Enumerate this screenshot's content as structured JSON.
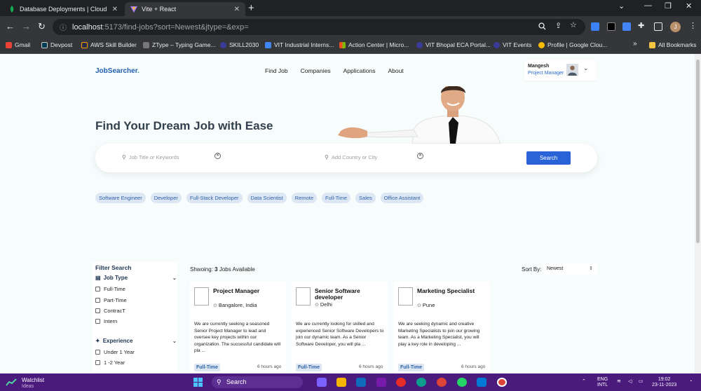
{
  "browser": {
    "tabs": [
      {
        "title": "Database Deployments | Cloud: Mc",
        "active": false,
        "icon": "mongodb-leaf-icon"
      },
      {
        "title": "Vite + React",
        "active": true,
        "icon": "vite-icon"
      }
    ],
    "address": {
      "host": "localhost",
      "path": ":5173/find-jobs?sort=Newest&jtype=&exp="
    },
    "bookmarks": [
      {
        "label": "Gmail",
        "icon": "gmail-icon",
        "color": "#ea4335"
      },
      {
        "label": "Devpost",
        "icon": "devpost-icon",
        "color": "#003e54"
      },
      {
        "label": "AWS Skill Builder",
        "icon": "aws-icon",
        "color": "#232f3e"
      },
      {
        "label": "ZType – Typing Game...",
        "icon": "ztype-icon",
        "color": "#777777"
      },
      {
        "label": "SKILL2030",
        "icon": "skill2030-icon",
        "color": "#3b3b9a"
      },
      {
        "label": "VIT Industrial Interns...",
        "icon": "google-forms-icon",
        "color": "#4285f4"
      },
      {
        "label": "Action Center | Micro...",
        "icon": "microsoft-icon",
        "color": "#f25022"
      },
      {
        "label": "VIT Bhopal ECA Portal...",
        "icon": "vit-icon",
        "color": "#3b3b9a"
      },
      {
        "label": "VIT Events",
        "icon": "vit-icon",
        "color": "#3b3b9a"
      },
      {
        "label": "Profile | Google Clou...",
        "icon": "google-cloud-icon",
        "color": "#fbbc05"
      }
    ],
    "bookmarks_more": "»",
    "all_bookmarks": "All Bookmarks"
  },
  "app": {
    "brand": "JobSearcher",
    "brand_dot": ".",
    "nav": [
      "Find Job",
      "Companies",
      "Applications",
      "About"
    ],
    "user": {
      "name": "Mangesh",
      "role": "Project Manager"
    },
    "hero_title": "Find Your Dream Job with Ease",
    "search": {
      "keyword_placeholder": "Job Title or Keywords",
      "location_placeholder": "Add Country or City",
      "button": "Search"
    },
    "popular_tags": [
      "Software Engineer",
      "Developer",
      "Full-Stack Developer",
      "Data Scientist",
      "Remote",
      "Full-Time",
      "Sales",
      "Office Assistant"
    ],
    "filter": {
      "heading": "Filter Search",
      "job_type_label": "Job Type",
      "job_types": [
        "Full-Time",
        "Part-Time",
        "ContracT",
        "Intern"
      ],
      "experience_label": "Experience",
      "experience": [
        "Under 1 Year",
        "1 -2 Year"
      ]
    },
    "results": {
      "prefix": "Shwoing: ",
      "count": "3",
      "suffix": " Jobs Available",
      "sort_label": "Sort By:",
      "sort_value": "Newest"
    },
    "jobs": [
      {
        "title": "Project Manager",
        "location": "Bangalore, India",
        "description": "We are currently seeking a seasoned Senior Project Manager to lead and oversee key projects within our organization. The successful candidate will pla ...",
        "type": "Full-Time",
        "posted": "6 hours ago"
      },
      {
        "title": "Senior Software developer",
        "location": "Delhi",
        "description": "We are currently looking for skilled and experienced Senior Software Developers to join our dynamic team. As a Senior Software Developer, you will pla ...",
        "type": "Full-Time",
        "posted": "6 hours ago"
      },
      {
        "title": "Marketing Specialist",
        "location": "Pune",
        "description": "We are seeking dynamic and creative Marketing Specialists to join our growing team. As a Marketing Specialist, you will play a key role in developing ...",
        "type": "Full-Time",
        "posted": "6 hours ago"
      }
    ]
  },
  "taskbar": {
    "widget_title": "Watchlist",
    "widget_sub": "Ideas",
    "search_label": "Search",
    "lang": "ENG",
    "region": "INTL",
    "time": "19:02",
    "date": "23-11-2023"
  },
  "colors": {
    "brand_blue": "#1f5fae",
    "accent_button": "#2a63d8",
    "tag_bg": "#dde6f3",
    "taskbar": "#4a1a7c"
  }
}
